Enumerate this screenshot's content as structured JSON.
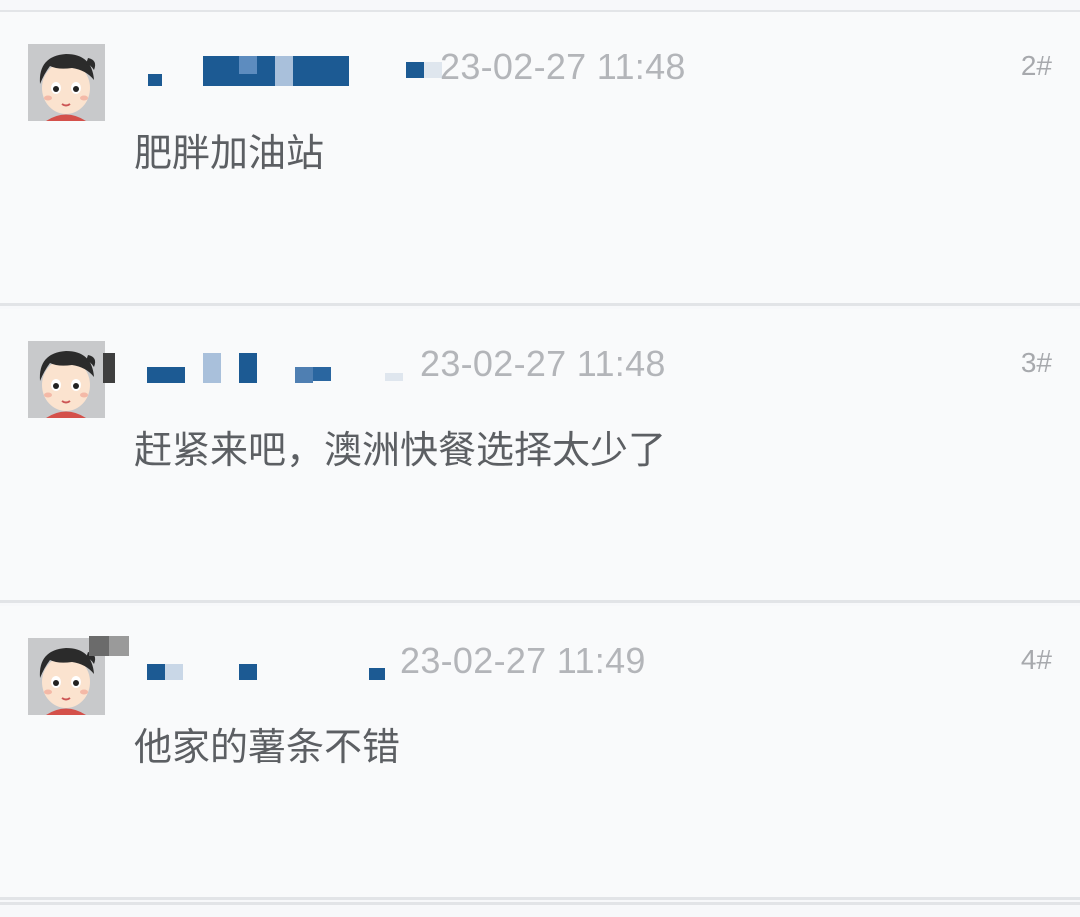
{
  "posts": [
    {
      "username": "",
      "date": "23-02-27 11:48",
      "floor": "2#",
      "content": "肥胖加油站",
      "avatar_icon": "cartoon-boy-avatar-icon"
    },
    {
      "username": "",
      "date": "23-02-27 11:48",
      "floor": "3#",
      "content": "赶紧来吧，澳洲快餐选择太少了",
      "avatar_icon": "cartoon-boy-avatar-icon"
    },
    {
      "username": "",
      "date": "23-02-27 11:49",
      "floor": "4#",
      "content": "他家的薯条不错",
      "avatar_icon": "cartoon-boy-avatar-icon"
    }
  ],
  "colors": {
    "background": "#f9fafb",
    "divider": "#e2e4e7",
    "date_text": "#b3b5b9",
    "content_text": "#5c5f63",
    "censor_blue": "#1c5a93"
  }
}
